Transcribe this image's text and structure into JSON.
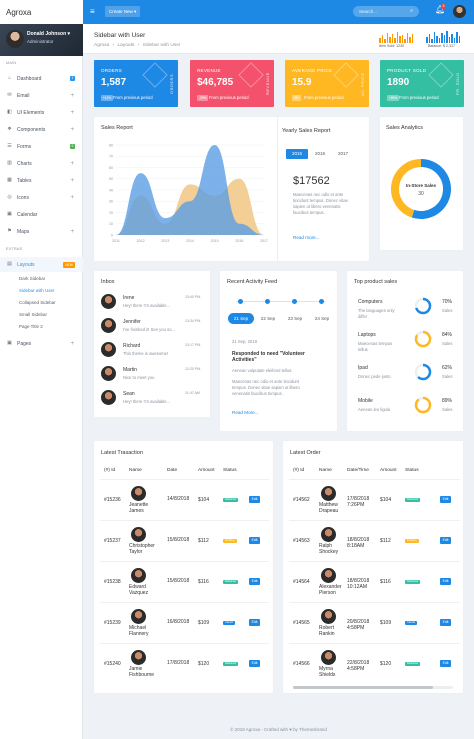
{
  "app": {
    "brand": "Agroxa"
  },
  "profile": {
    "name": "Donald Johnson",
    "role": "Administrator"
  },
  "sidebar": {
    "sections": {
      "main": "MAIN",
      "extras": "EXTRAS"
    },
    "items": [
      {
        "label": "Dashboard",
        "icon": "dashboard-icon",
        "badge": "1"
      },
      {
        "label": "Email",
        "icon": "email-icon",
        "plus": "+"
      },
      {
        "label": "UI Elements",
        "icon": "ui-elements-icon",
        "plus": "+"
      },
      {
        "label": "Components",
        "icon": "components-icon",
        "plus": "+"
      },
      {
        "label": "Forms",
        "icon": "forms-icon",
        "badge": "6"
      },
      {
        "label": "Charts",
        "icon": "charts-icon",
        "plus": "+"
      },
      {
        "label": "Tables",
        "icon": "tables-icon",
        "plus": "+"
      },
      {
        "label": "Icons",
        "icon": "icons-icon",
        "plus": "+"
      },
      {
        "label": "Calendar",
        "icon": "calendar-icon"
      },
      {
        "label": "Maps",
        "icon": "maps-icon",
        "plus": "+"
      }
    ],
    "layouts": {
      "label": "Layouts",
      "tag": "NEW",
      "subs": [
        "Dark Sidebar",
        "Sidebar with User",
        "Collapsed Sidebar",
        "Small Sidebar",
        "Page Title 2"
      ]
    },
    "pages": {
      "label": "Pages",
      "plus": "+"
    }
  },
  "topbar": {
    "create": "Create New ▾",
    "search_placeholder": "Search...",
    "notif_count": "3"
  },
  "pagehead": {
    "title": "Sidebar with User",
    "crumbs": [
      "Agroxa",
      "›",
      "Layouts",
      "›",
      "Sidebar with User"
    ],
    "stat1": "Item Sold: 1230",
    "stat2": "Balance: $ 2,317"
  },
  "stats": [
    {
      "label": "ORDERS",
      "value": "1,587",
      "pill": "+11%",
      "sub": "From previous period",
      "vert": "ORDERS",
      "color": "#1e88e5"
    },
    {
      "label": "REVENUE",
      "value": "$46,785",
      "pill": "-29%",
      "sub": "From previous period",
      "vert": "REVENUE",
      "color": "#f4516c"
    },
    {
      "label": "AVERAGE PRICE",
      "value": "15.9",
      "pill": "0%",
      "sub": "From previous period",
      "vert": "AV. PRICE",
      "color": "#ffb822"
    },
    {
      "label": "PRODUCT SOLD",
      "value": "1890",
      "pill": "+89%",
      "sub": "From previous period",
      "vert": "PR. SOLD",
      "color": "#34bfa3"
    }
  ],
  "sales_report": {
    "title": "Sales Report"
  },
  "chart_data": {
    "type": "area",
    "x": [
      "2011",
      "2012",
      "2013",
      "2014",
      "2015",
      "2016",
      "2017"
    ],
    "yticks": [
      "0",
      "10",
      "20",
      "30",
      "40",
      "50",
      "60",
      "70",
      "80"
    ],
    "ylim": [
      0,
      80
    ],
    "series": [
      {
        "values": [
          0,
          35,
          10,
          45,
          35,
          50,
          0
        ],
        "color": "#f0c37a"
      },
      {
        "values": [
          0,
          55,
          15,
          30,
          80,
          10,
          0
        ],
        "color": "#5b9ee5"
      }
    ]
  },
  "yearly": {
    "title": "Yearly Sales Report",
    "tabs": [
      "2015",
      "2016",
      "2017"
    ],
    "amount": "$17562",
    "text": "Maecenas nec odio et ante tincidunt tempus. Donec vitae sapien ut libero venenatis faucibus tempus.",
    "more": "Read more..."
  },
  "analytics": {
    "title": "Sales Analytics",
    "donut_label": "In-Store Sales",
    "donut_value": "30",
    "segments": [
      {
        "pct": 0.55,
        "color": "#1e88e5"
      },
      {
        "pct": 0.45,
        "color": "#ffb822"
      }
    ]
  },
  "inbox": {
    "title": "Inbox",
    "items": [
      {
        "name": "Irene",
        "msg": "Hey! there I'm available...",
        "time": "13:40 PM"
      },
      {
        "name": "Jennifer",
        "msg": "I've finished it! See you so...",
        "time": "13:34 PM"
      },
      {
        "name": "Richard",
        "msg": "This theme is awesome!",
        "time": "13:17 PM"
      },
      {
        "name": "Martin",
        "msg": "Nice to meet you",
        "time": "12:20 PM"
      },
      {
        "name": "Sean",
        "msg": "Hey! there I'm available...",
        "time": "11:47 AM"
      }
    ]
  },
  "activity": {
    "title": "Recent Activity Feed",
    "dates": [
      "21 Sep",
      "22 Sep",
      "23 Sep",
      "24 Sep"
    ],
    "date": "21 Sep, 2018",
    "heading": "Responded to need \"Volunteer Activities\"",
    "p1": "Aenean vulputate eleifend tellus.",
    "p2": "Maecenas nec odio et ante tincidunt tempus. Donec vitae sapien ut libero venenatis faucibus tempus.",
    "more": "Read More..."
  },
  "products": {
    "title": "Top product sales",
    "items": [
      {
        "name": "Computers",
        "desc": "The languages only differ",
        "pct": "70%",
        "lab": "Sales",
        "fill": 0.7
      },
      {
        "name": "Laptops",
        "desc": "Maecenas tempus tellus",
        "pct": "84%",
        "lab": "Sales",
        "fill": 0.84
      },
      {
        "name": "Ipad",
        "desc": "Donec pede justo",
        "pct": "62%",
        "lab": "Sales",
        "fill": 0.62
      },
      {
        "name": "Mobile",
        "desc": "Aenean leo ligula",
        "pct": "89%",
        "lab": "Sales",
        "fill": 0.89
      }
    ]
  },
  "transactions": {
    "title": "Latest Trasaction",
    "cols": [
      "(#) Id",
      "Name",
      "Date",
      "Amount",
      "Status",
      ""
    ],
    "rows": [
      {
        "id": "#15236",
        "name": "Jeanette James",
        "date": "14/8/2018",
        "amount": "$104",
        "status": "Delivered",
        "color": "#34bfa3",
        "btn": "Edit"
      },
      {
        "id": "#15237",
        "name": "Christopher Taylor",
        "date": "15/8/2018",
        "amount": "$112",
        "status": "Pending",
        "color": "#ffb822",
        "btn": "Edit"
      },
      {
        "id": "#15238",
        "name": "Edward Vazquez",
        "date": "15/8/2018",
        "amount": "$116",
        "status": "Delivered",
        "color": "#34bfa3",
        "btn": "Edit"
      },
      {
        "id": "#15239",
        "name": "Michael Flannery",
        "date": "16/8/2018",
        "amount": "$109",
        "status": "Cancel",
        "color": "#1e88e5",
        "btn": "Edit"
      },
      {
        "id": "#15240",
        "name": "Jamie Fishbourne",
        "date": "17/8/2018",
        "amount": "$120",
        "status": "Delivered",
        "color": "#34bfa3",
        "btn": "Edit"
      }
    ]
  },
  "orders": {
    "title": "Latest Order",
    "cols": [
      "(#) Id",
      "Name",
      "Date/Time",
      "Amount",
      "Status",
      ""
    ],
    "rows": [
      {
        "id": "#14562",
        "name": "Matthew Drapeau",
        "date": "17/8/2018 7:26PM",
        "amount": "$104",
        "status": "Delivered",
        "color": "#34bfa3",
        "btn": "Edit"
      },
      {
        "id": "#14563",
        "name": "Ralph Shockey",
        "date": "18/8/2018 8:18AM",
        "amount": "$112",
        "status": "Pending",
        "color": "#ffb822",
        "btn": "Edit"
      },
      {
        "id": "#14564",
        "name": "Alexander Pierson",
        "date": "18/8/2018 10:12AM",
        "amount": "$116",
        "status": "Delivered",
        "color": "#34bfa3",
        "btn": "Edit"
      },
      {
        "id": "#14565",
        "name": "Robert Rankin",
        "date": "20/8/2018 4:58PM",
        "amount": "$109",
        "status": "Cancel",
        "color": "#1e88e5",
        "btn": "Edit"
      },
      {
        "id": "#14566",
        "name": "Myrna Shields",
        "date": "22/8/2018 4:58PM",
        "amount": "$120",
        "status": "Delivered",
        "color": "#34bfa3",
        "btn": "Edit"
      }
    ]
  },
  "footer": "© 2018 Agroxa - Crafted with ♥ by Themesbrand"
}
